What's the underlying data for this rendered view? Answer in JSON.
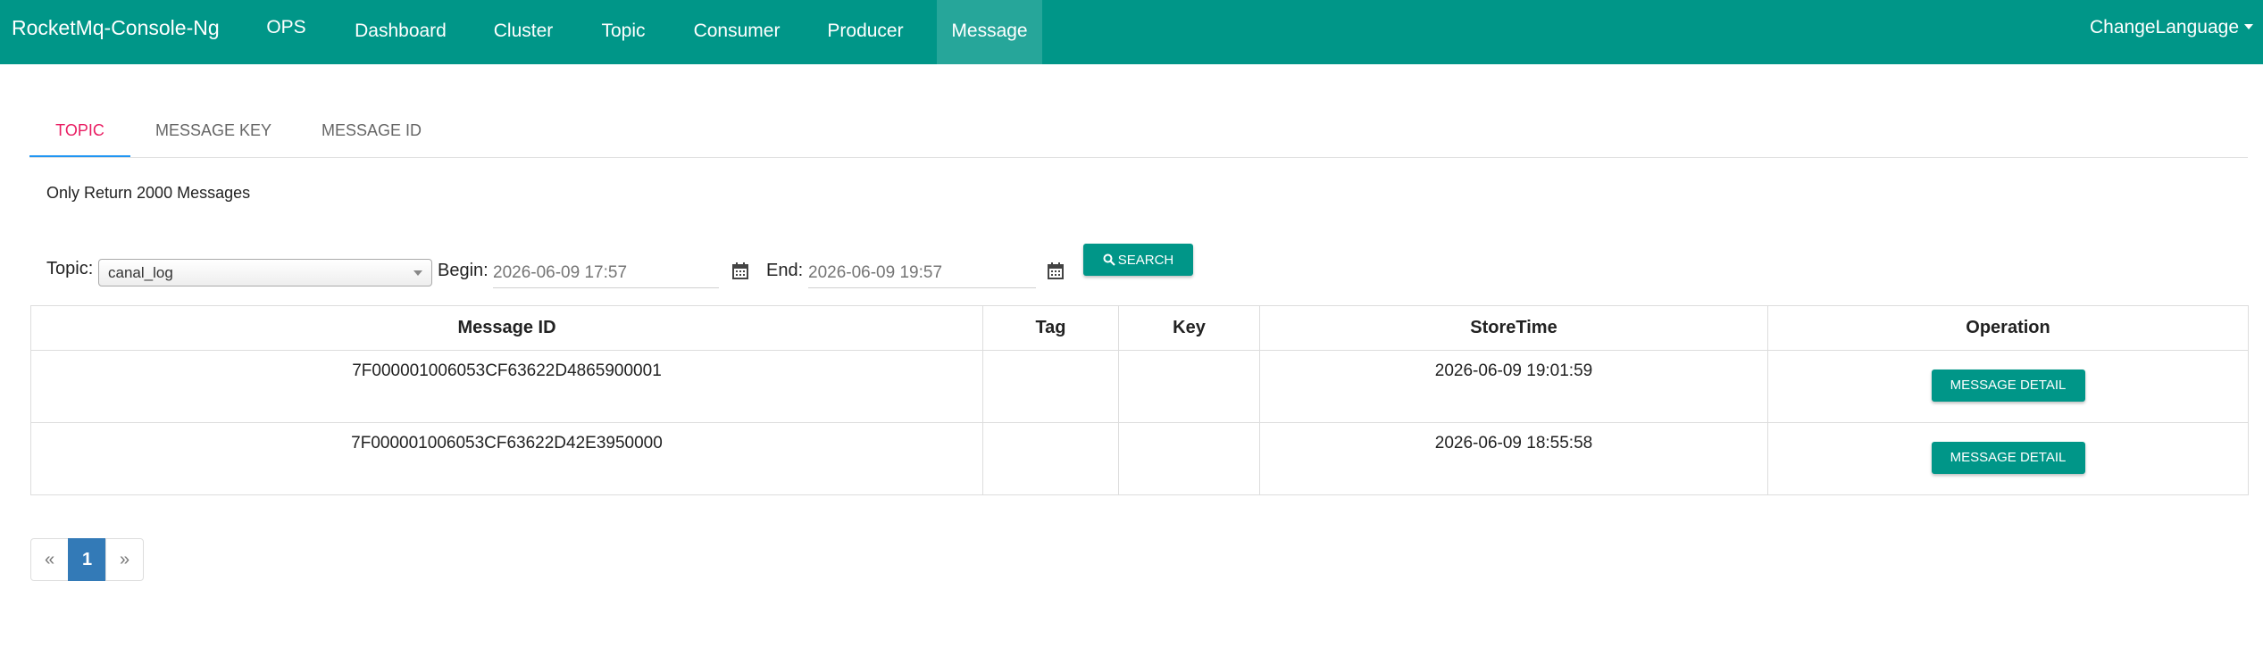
{
  "navbar": {
    "brand": "RocketMq-Console-Ng",
    "items": [
      {
        "label": "OPS"
      },
      {
        "label": "Dashboard"
      },
      {
        "label": "Cluster"
      },
      {
        "label": "Topic"
      },
      {
        "label": "Consumer"
      },
      {
        "label": "Producer"
      },
      {
        "label": "Message"
      }
    ],
    "active": "Message",
    "language_label": "ChangeLanguage",
    "color": "#009688"
  },
  "tabs": [
    {
      "label": "TOPIC",
      "active": true
    },
    {
      "label": "MESSAGE KEY",
      "active": false
    },
    {
      "label": "MESSAGE ID",
      "active": false
    }
  ],
  "note": "Only Return 2000 Messages",
  "search": {
    "topic_label": "Topic:",
    "topic_value": "canal_log",
    "begin_label": "Begin:",
    "begin_placeholder": "2026-06-09 17:57",
    "end_label": "End:",
    "end_placeholder": "2026-06-09 19:57",
    "button_label": "SEARCH"
  },
  "table": {
    "headers": [
      "Message ID",
      "Tag",
      "Key",
      "StoreTime",
      "Operation"
    ],
    "rows": [
      {
        "message_id": "7F000001006053CF63622D4865900001",
        "tag": "",
        "key": "",
        "store_time": "2026-06-09 19:01:59",
        "operation": "MESSAGE DETAIL"
      },
      {
        "message_id": "7F000001006053CF63622D42E3950000",
        "tag": "",
        "key": "",
        "store_time": "2026-06-09 18:55:58",
        "operation": "MESSAGE DETAIL"
      }
    ]
  },
  "pagination": {
    "prev": "«",
    "pages": [
      "1"
    ],
    "next": "»",
    "current": "1"
  }
}
